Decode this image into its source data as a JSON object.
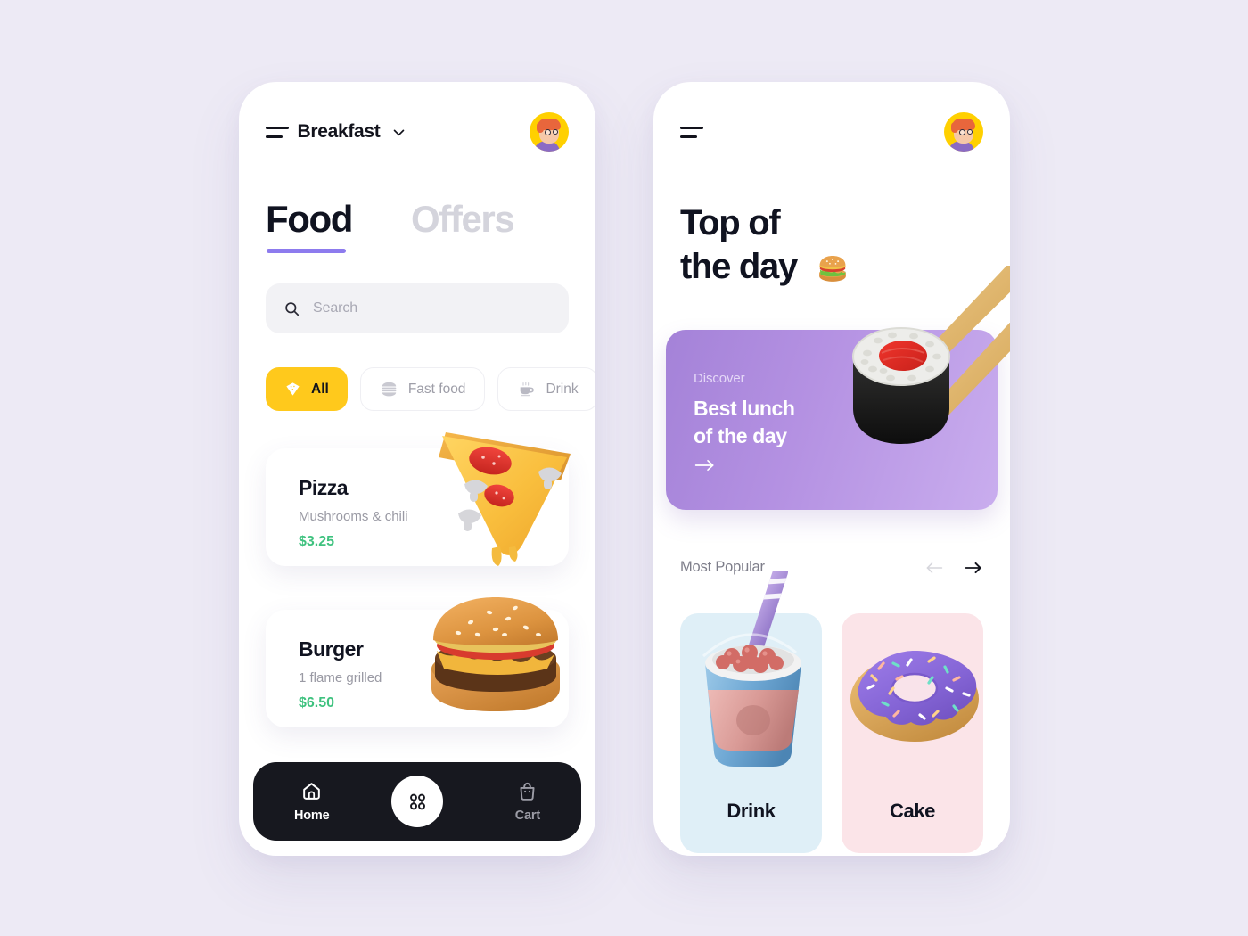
{
  "page": {
    "background_color": "#EDEAF5"
  },
  "left_screen": {
    "topbar": {
      "menu_icon": "hamburger-icon",
      "title": "Breakfast",
      "chevron_icon": "chevron-down-icon",
      "avatar_icon": "user-avatar"
    },
    "tabs": [
      {
        "label": "Food",
        "active": true
      },
      {
        "label": "Offers",
        "active": false
      }
    ],
    "tab_underline_color": "#8D7BEE",
    "search": {
      "icon": "search-icon",
      "placeholder": "Search",
      "value": ""
    },
    "categories": [
      {
        "label": "All",
        "icon": "pizza-slice-icon",
        "selected": true
      },
      {
        "label": "Fast food",
        "icon": "burger-icon",
        "selected": false
      },
      {
        "label": "Drink",
        "icon": "coffee-cup-icon",
        "selected": false
      }
    ],
    "selected_chip_color": "#FFC91C",
    "food_items": [
      {
        "name": "Pizza",
        "description": "Mushrooms & chili",
        "price": "$3.25",
        "art": "pizza-slice-3d"
      },
      {
        "name": "Burger",
        "description": "1 flame grilled",
        "price": "$6.50",
        "art": "burger-3d"
      }
    ],
    "price_color": "#3FC27F",
    "bottom_nav": {
      "background_color": "#17181F",
      "items": [
        {
          "label": "Home",
          "icon": "home-icon",
          "active": true
        },
        {
          "label": "Cart",
          "icon": "shopping-bag-icon",
          "active": false
        }
      ],
      "fab_icon": "grid-dots-icon"
    }
  },
  "right_screen": {
    "topbar": {
      "menu_icon": "hamburger-icon",
      "avatar_icon": "user-avatar"
    },
    "heading": "Top of\nthe day",
    "heading_emoji": "burger-emoji",
    "banner": {
      "kicker": "Discover",
      "title": "Best lunch\nof the day",
      "arrow_icon": "arrow-right-icon",
      "art": "sushi-roll-chopsticks-3d",
      "gradient_from": "#A482D8",
      "gradient_to": "#C9ADEE"
    },
    "section": {
      "title": "Most Popular",
      "prev_icon": "arrow-left-icon",
      "next_icon": "arrow-right-icon",
      "prev_enabled": false,
      "next_enabled": true
    },
    "popular_cards": [
      {
        "label": "Drink",
        "art": "bubble-tea-3d",
        "background_color": "#DFEFF7"
      },
      {
        "label": "Cake",
        "art": "donut-3d",
        "background_color": "#FBE4E8"
      }
    ]
  }
}
